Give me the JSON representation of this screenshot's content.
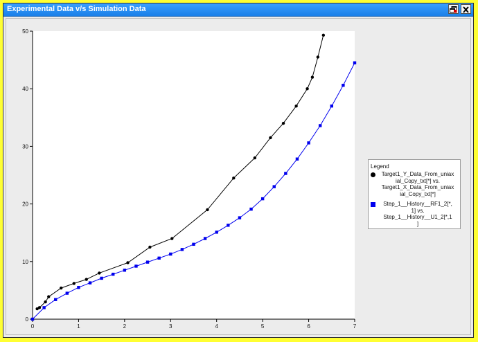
{
  "window": {
    "title": "Experimental Data v/s Simulation Data",
    "title_color": "#1a7fe8",
    "border_color": "#ffff33",
    "restore_icon": "restore-window-icon",
    "close_icon": "close-icon"
  },
  "legend": {
    "title": "Legend",
    "entries": [
      {
        "lines": [
          "Target1_Y_Data_From_uniax",
          "ial_Copy_txt[*] vs.",
          "Target1_X_Data_From_uniax",
          "ial_Copy_txt[*]"
        ],
        "marker": "circle",
        "color": "#000000"
      },
      {
        "lines": [
          "Step_1__History__RF1_2[*,",
          "1] vs.",
          "Step_1__History__U1_2[*,1",
          "]"
        ],
        "marker": "square",
        "color": "#0000ee"
      }
    ]
  },
  "chart_data": {
    "type": "line",
    "xlim": [
      0,
      7
    ],
    "ylim": [
      0,
      50
    ],
    "xticks": [
      0,
      1,
      2,
      3,
      4,
      5,
      6,
      7
    ],
    "yticks": [
      0,
      10,
      20,
      30,
      40,
      50
    ],
    "grid": false,
    "legend_position": "right",
    "series": [
      {
        "name": "Target1_Y_Data_From_uniaxial_Copy_txt[*] vs. Target1_X_Data_From_uniaxial_Copy_txt[*]",
        "color": "#000000",
        "marker": "circle",
        "x": [
          0.1,
          0.15,
          0.28,
          0.35,
          0.62,
          0.9,
          1.17,
          1.45,
          2.07,
          2.55,
          3.03,
          3.8,
          4.37,
          4.83,
          5.17,
          5.45,
          5.73,
          5.97,
          6.08,
          6.2,
          6.32
        ],
        "y": [
          1.8,
          2.0,
          3.0,
          3.9,
          5.4,
          6.2,
          6.9,
          8.0,
          9.8,
          12.5,
          14.0,
          19.0,
          24.5,
          28.0,
          31.5,
          34.0,
          37.0,
          40.0,
          42.0,
          45.5,
          49.3
        ]
      },
      {
        "name": "Step_1__History__RF1_2[*,1] vs. Step_1__History__U1_2[*,1]",
        "color": "#0000ee",
        "marker": "square",
        "x": [
          0.0,
          0.25,
          0.5,
          0.75,
          1.0,
          1.25,
          1.5,
          1.75,
          2.0,
          2.25,
          2.5,
          2.75,
          3.0,
          3.25,
          3.5,
          3.75,
          4.0,
          4.25,
          4.5,
          4.75,
          5.0,
          5.25,
          5.5,
          5.75,
          6.0,
          6.25,
          6.5,
          6.75,
          7.0
        ],
        "y": [
          0.0,
          2.0,
          3.4,
          4.5,
          5.5,
          6.3,
          7.1,
          7.8,
          8.5,
          9.2,
          9.9,
          10.6,
          11.3,
          12.1,
          13.0,
          14.0,
          15.1,
          16.3,
          17.6,
          19.1,
          20.9,
          23.0,
          25.3,
          27.8,
          30.6,
          33.6,
          37.0,
          40.6,
          44.5
        ]
      }
    ]
  }
}
